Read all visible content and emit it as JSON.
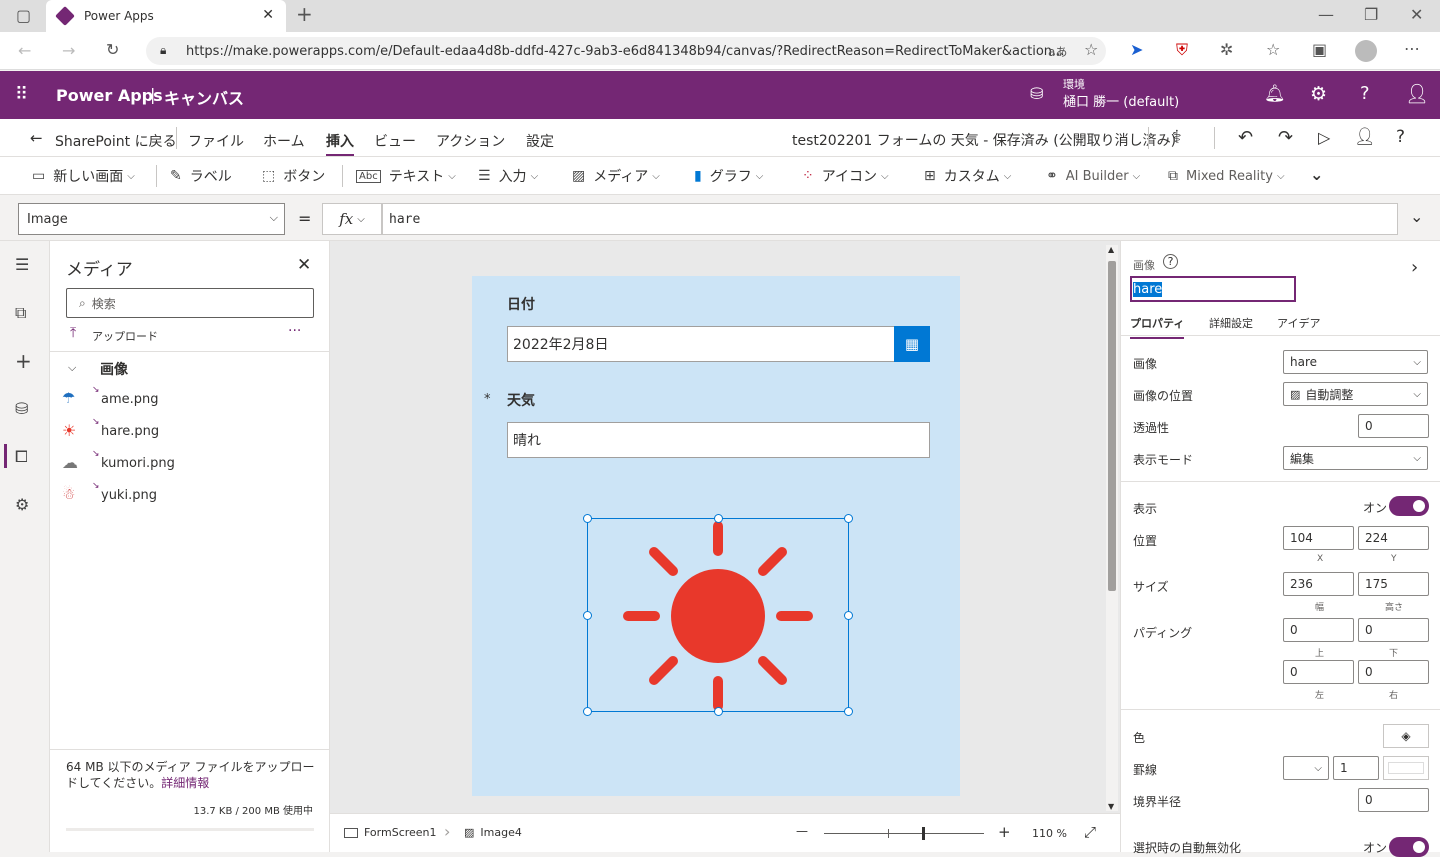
{
  "browser": {
    "tab_title": "Power Apps",
    "url": "https://make.powerapps.com/e/Default-edaa4d8b-ddfd-427c-9ab3-e6d841348b94/canvas/?RedirectReason=RedirectToMaker&action..."
  },
  "app_header": {
    "brand": "Power Apps",
    "separator": "|",
    "section": "キャンバス",
    "env_label": "環境",
    "env_name": "樋口 勝一 (default)"
  },
  "command_bar": {
    "back_label": "SharePoint に戻る",
    "menus": [
      "ファイル",
      "ホーム",
      "挿入",
      "ビュー",
      "アクション",
      "設定"
    ],
    "active_menu": "挿入",
    "doc_status": "test202201 フォームの 天気 - 保存済み (公開取り消し済み)"
  },
  "ribbon": {
    "items": [
      "新しい画面",
      "ラベル",
      "ボタン",
      "テキスト",
      "入力",
      "メディア",
      "グラフ",
      "アイコン",
      "カスタム",
      "AI Builder",
      "Mixed Reality"
    ]
  },
  "formula_bar": {
    "property": "Image",
    "equals": "=",
    "fx": "fx",
    "formula": "hare"
  },
  "media_pane": {
    "title": "メディア",
    "search_placeholder": "検索",
    "upload_label": "アップロード",
    "more": "···",
    "group_label": "画像",
    "files": [
      "ame.png",
      "hare.png",
      "kumori.png",
      "yuki.png"
    ],
    "footer_text": "64 MB 以下のメディア ファイルをアップロードしてください。",
    "footer_link": "詳細情報",
    "usage": "13.7 KB / 200 MB 使用中"
  },
  "canvas": {
    "date_label": "日付",
    "date_value": "2022年2月8日",
    "required_mark": "*",
    "weather_label": "天気",
    "weather_value": "晴れ"
  },
  "status_bar": {
    "screen_name": "FormScreen1",
    "control_name": "Image4",
    "zoom_minus": "—",
    "zoom_plus": "+",
    "zoom_level": "110 %",
    "zoom_fraction": 0.62
  },
  "properties": {
    "type_label": "画像",
    "control_name": "hare",
    "tabs": [
      "プロパティ",
      "詳細設定",
      "アイデア"
    ],
    "image_label": "画像",
    "image_value": "hare",
    "image_pos_label": "画像の位置",
    "image_pos_value": "自動調整",
    "transparency_label": "透過性",
    "transparency_value": "0",
    "display_mode_label": "表示モード",
    "display_mode_value": "編集",
    "visible_label": "表示",
    "visible_value": "オン",
    "position_label": "位置",
    "x": "104",
    "y": "224",
    "x_cap": "X",
    "y_cap": "Y",
    "size_label": "サイズ",
    "width": "236",
    "height": "175",
    "width_cap": "幅",
    "height_cap": "高さ",
    "padding_label": "パディング",
    "pad_top": "0",
    "pad_bottom": "0",
    "pad_left": "0",
    "pad_right": "0",
    "pad_top_cap": "上",
    "pad_bottom_cap": "下",
    "pad_left_cap": "左",
    "pad_right_cap": "右",
    "color_label": "色",
    "border_label": "罫線",
    "border_width": "1",
    "radius_label": "境界半径",
    "radius_value": "0",
    "auto_disable_label": "選択時の自動無効化",
    "auto_disable_value": "オン"
  },
  "colors": {
    "brand": "#742774",
    "sun": "#e8382b",
    "accent": "#0078d4",
    "screen_bg": "#cce4f6"
  }
}
